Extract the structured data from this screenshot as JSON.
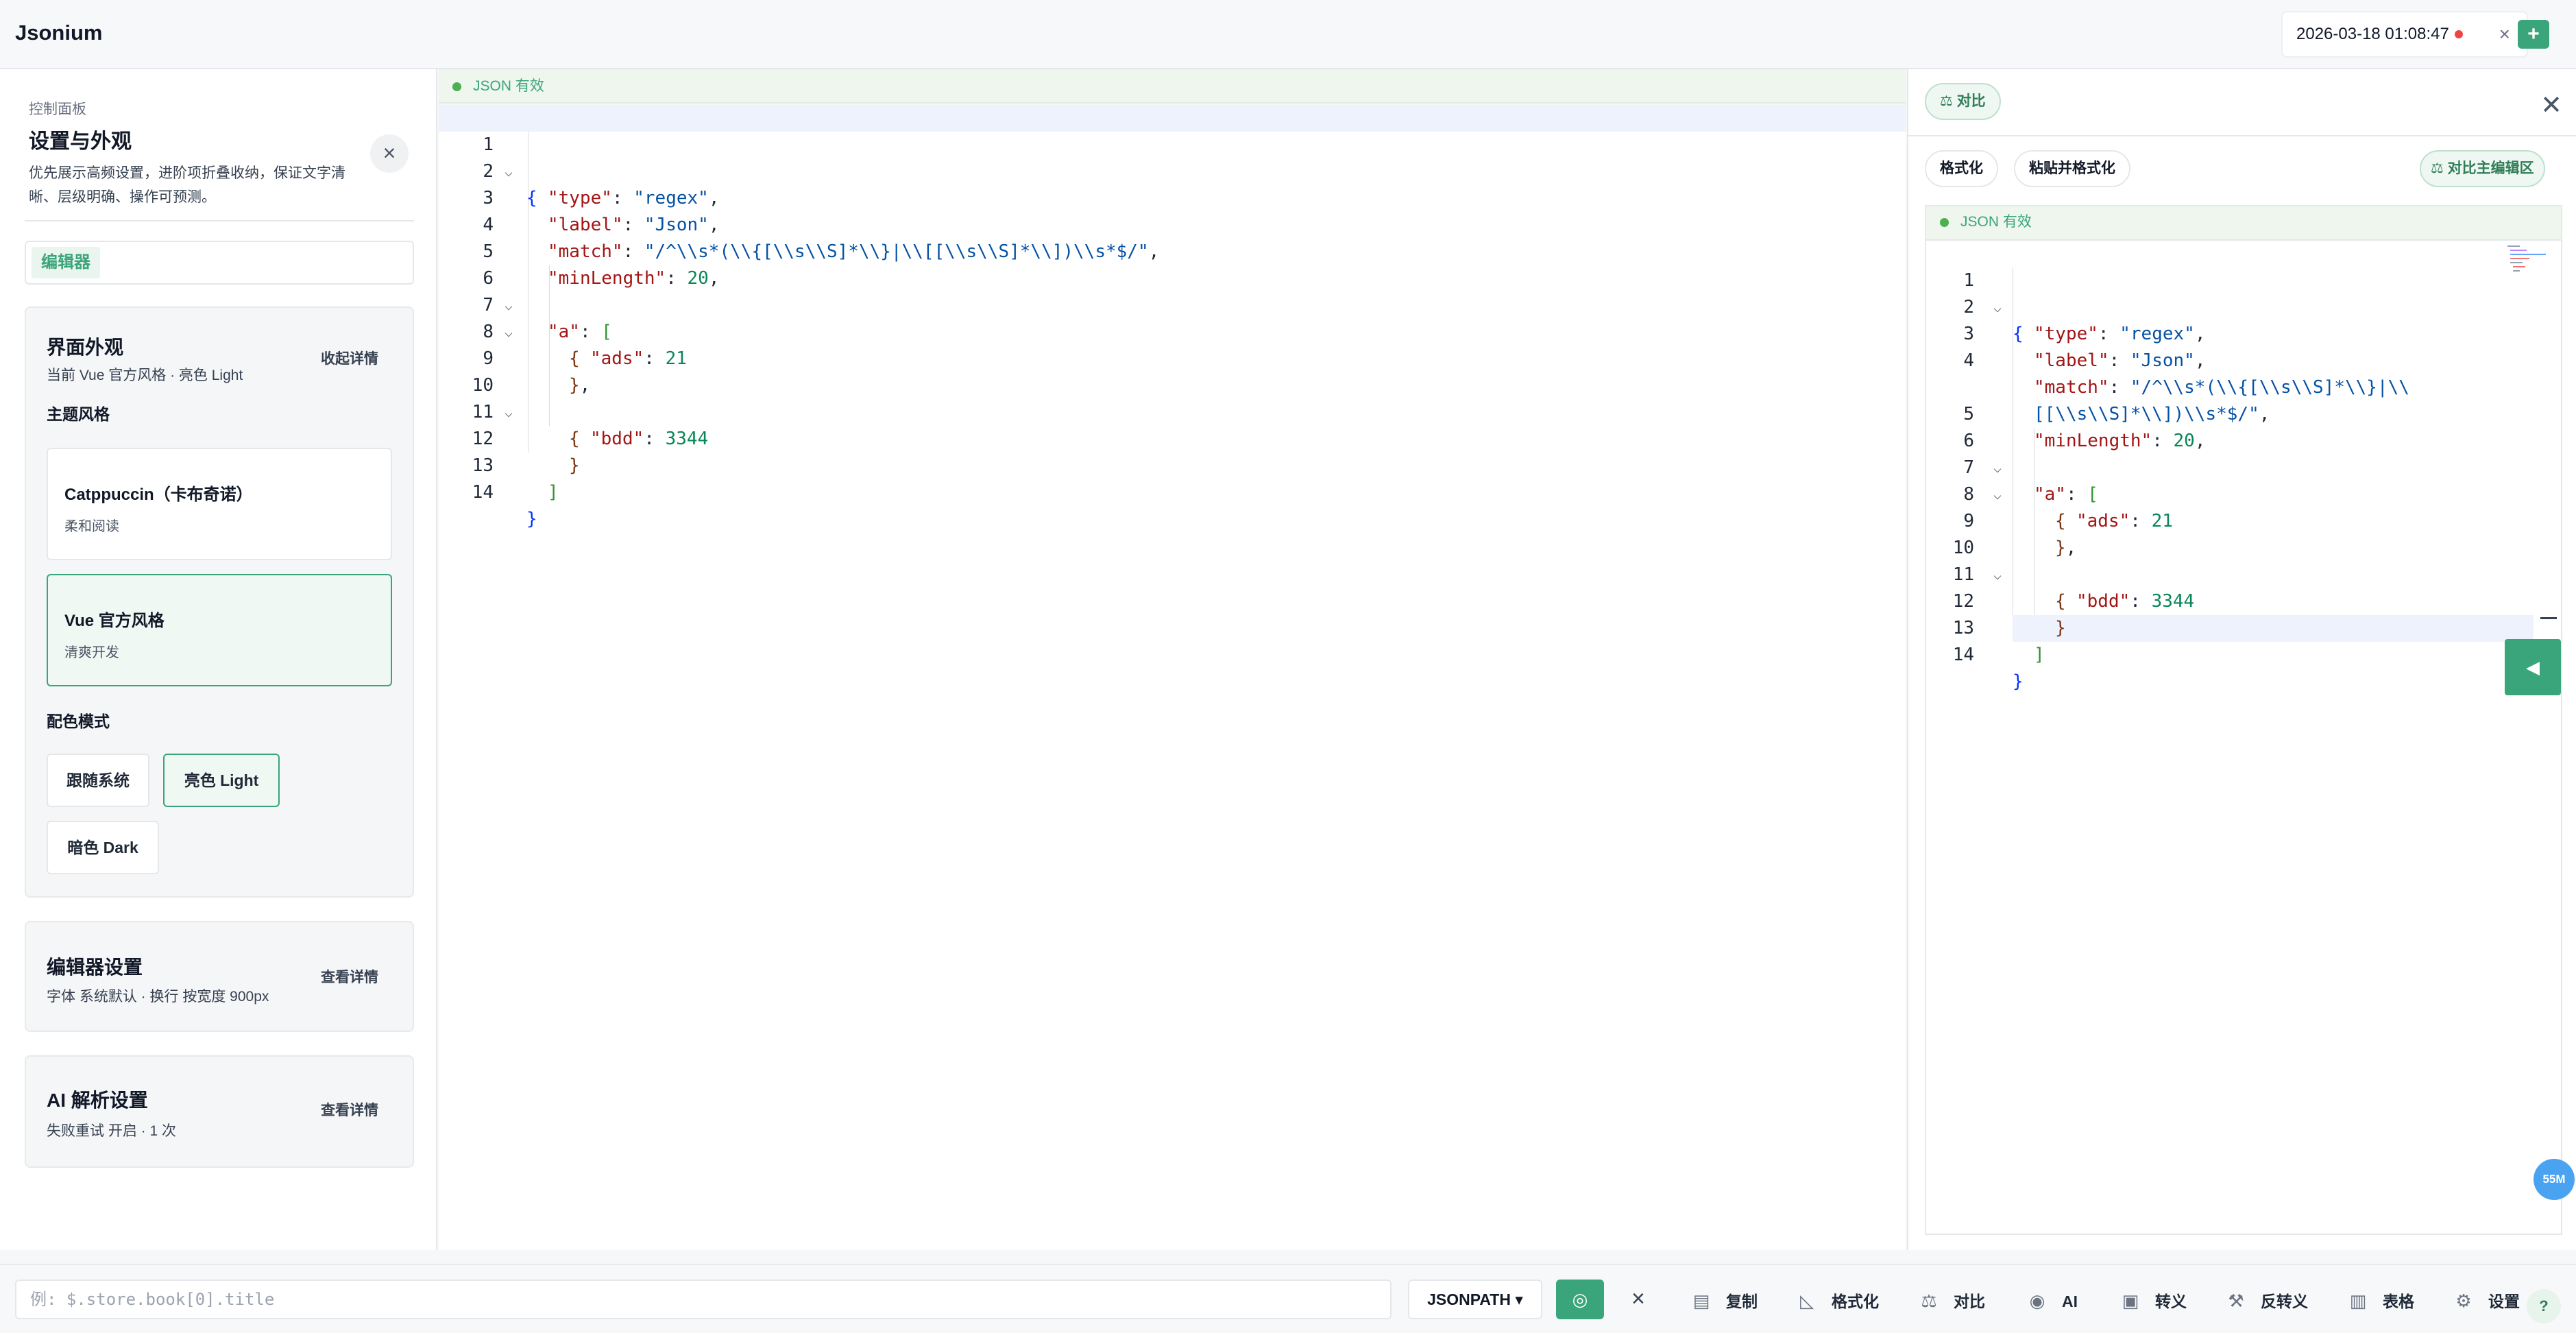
{
  "app": {
    "title": "Jsonium"
  },
  "tab": {
    "label": "2026-03-18 01:08:47",
    "close": "×",
    "add": "+"
  },
  "settings": {
    "kicker": "控制面板",
    "title": "设置与外观",
    "description": "优先展示高频设置，进阶项折叠收纳，保证文字清晰、层级明确、操作可预测。",
    "close": "×",
    "tabs": [
      "编辑器"
    ],
    "appearance": {
      "title": "界面外观",
      "subtitle": "当前 Vue 官方风格 · 亮色 Light",
      "toggle": "收起详情",
      "theme_label": "主题风格",
      "themes": [
        {
          "name": "Catppuccin（卡布奇诺）",
          "desc": "柔和阅读"
        },
        {
          "name": "Vue 官方风格",
          "desc": "清爽开发"
        }
      ],
      "mode_label": "配色模式",
      "modes": [
        "跟随系统",
        "亮色 Light",
        "暗色 Dark"
      ]
    },
    "editor_card": {
      "title": "编辑器设置",
      "subtitle": "字体 系统默认 · 换行 按宽度 900px",
      "link": "查看详情"
    },
    "ai_card": {
      "title": "AI 解析设置",
      "subtitle": "失败重试 开启 · 1 次",
      "link": "查看详情"
    }
  },
  "main_editor": {
    "status": "JSON 有效",
    "line_numbers": [
      "1",
      "2",
      "3",
      "4",
      "5",
      "6",
      "7",
      "8",
      "9",
      "10",
      "11",
      "12",
      "13",
      "14"
    ]
  },
  "code": {
    "open_brace": "{",
    "close_brace": "}",
    "key_type": "\"type\"",
    "val_type": "\"regex\"",
    "key_label": "\"label\"",
    "val_label": "\"Json\"",
    "key_match": "\"match\"",
    "val_match": "\"/^\\\\s*(\\\\{[\\\\s\\\\S]*\\\\}|\\\\[[\\\\s\\\\S]*\\\\])\\\\s*$/\"",
    "val_match_part1": "\"/^\\\\s*(\\\\{[\\\\s\\\\S]*\\\\}|\\\\",
    "val_match_part2": "[[\\\\s\\\\S]*\\\\])\\\\s*$/\"",
    "key_minLength": "\"minLength\"",
    "val_minLength": "20",
    "key_a": "\"a\"",
    "open_bracket": "[",
    "close_bracket": "]",
    "key_ads": "\"ads\"",
    "val_ads": "21",
    "key_bdd": "\"bdd\"",
    "val_bdd": "3344",
    "colon": ": ",
    "comma": ","
  },
  "compare": {
    "badge": "⚖ 对比",
    "close": "✕",
    "format": "格式化",
    "paste_format": "粘贴并格式化",
    "compare_main": "⚖ 对比主编辑区",
    "status": "JSON 有效",
    "line_numbers": [
      "1",
      "2",
      "3",
      "4",
      "",
      "5",
      "6",
      "7",
      "8",
      "9",
      "10",
      "11",
      "12",
      "13",
      "14"
    ],
    "side_arrow": "◀",
    "memory": "55M"
  },
  "bottombar": {
    "jsonpath_placeholder": "例: $.store.book[0].title",
    "jsonpath_value": "",
    "mode": "JSONPATH ▾",
    "run": "◎",
    "clear": "×",
    "tools": [
      {
        "icon": "clipboard-icon",
        "glyph": "▤",
        "label": "复制"
      },
      {
        "icon": "ruler-icon",
        "glyph": "◺",
        "label": "格式化"
      },
      {
        "icon": "scale-icon",
        "glyph": "⚖",
        "label": "对比"
      },
      {
        "icon": "robot-icon",
        "glyph": "◉",
        "label": "AI"
      },
      {
        "icon": "lock-icon",
        "glyph": "▣",
        "label": "转义"
      },
      {
        "icon": "wrench-icon",
        "glyph": "⚒",
        "label": "反转义"
      },
      {
        "icon": "chart-icon",
        "glyph": "▥",
        "label": "表格"
      },
      {
        "icon": "gear-icon",
        "glyph": "⚙",
        "label": "设置"
      }
    ],
    "help": "?"
  },
  "colors": {
    "accent": "#3aa57a",
    "valid": "#4caf50",
    "unsaved_dot": "#ef4444",
    "memory": "#4aa3f0"
  }
}
